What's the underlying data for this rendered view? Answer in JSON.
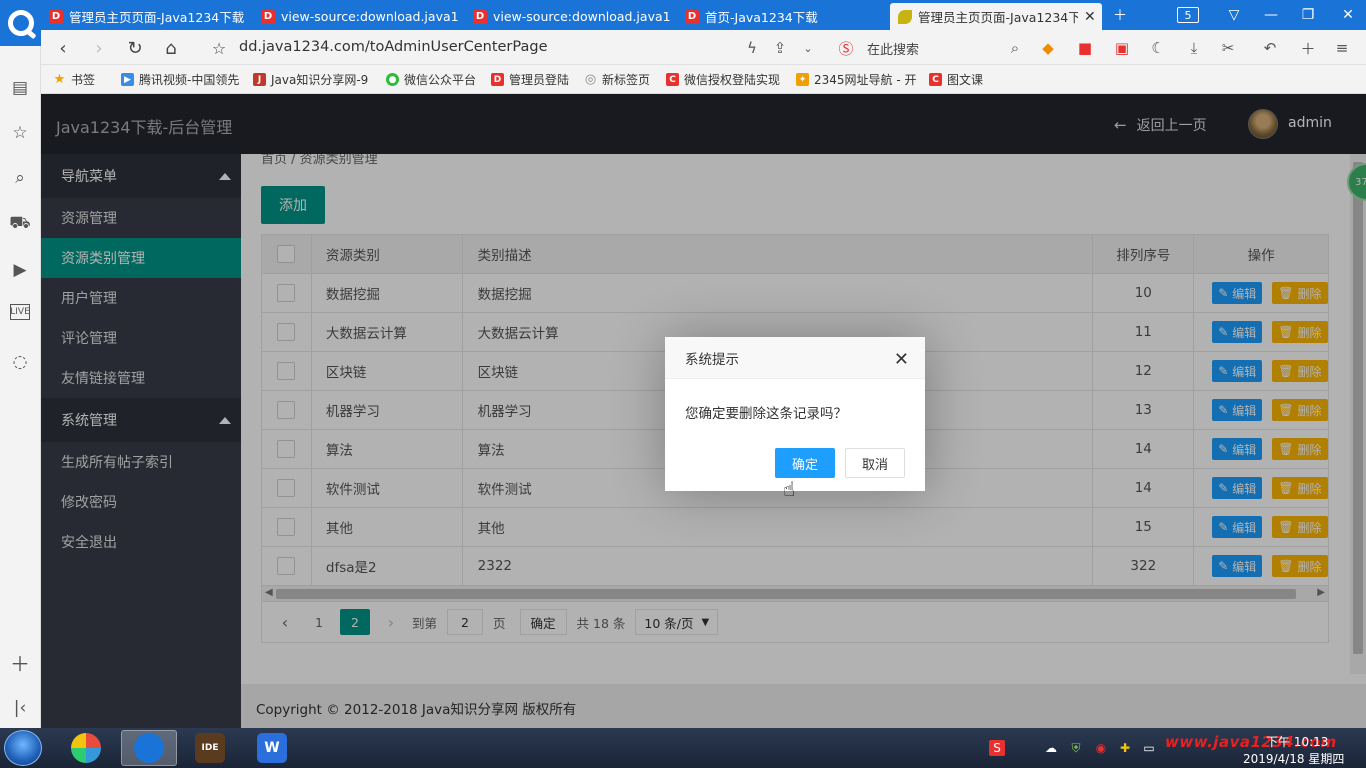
{
  "browser": {
    "tabs": [
      {
        "label": "管理员主页页面-Java1234下载",
        "favicon": "D",
        "active": false
      },
      {
        "label": "view-source:download.java1",
        "favicon": "D",
        "active": false
      },
      {
        "label": "view-source:download.java1",
        "favicon": "D",
        "active": false
      },
      {
        "label": "首页-Java1234下载",
        "favicon": "D",
        "active": false
      },
      {
        "label": "管理员主页页面-Java1234下载",
        "favicon": "",
        "active": true
      }
    ],
    "tab_count": "5",
    "url": "dd.java1234.com/toAdminUserCenterPage",
    "search_placeholder": "在此搜索",
    "bookmarks": [
      {
        "label": "书签",
        "color": "#f0a000"
      },
      {
        "label": "腾讯视频-中国领先",
        "color": "#3c8ce7"
      },
      {
        "label": "Java知识分享网-9",
        "color": "#c0392b"
      },
      {
        "label": "微信公众平台",
        "color": "#2dbb39"
      },
      {
        "label": "管理员登陆",
        "color": "#e8312f"
      },
      {
        "label": "新标签页",
        "color": "#888888"
      },
      {
        "label": "微信授权登陆实现",
        "color": "#e8312f"
      },
      {
        "label": "2345网址导航 - 开",
        "color": "#f0a000"
      },
      {
        "label": "图文课",
        "color": "#e8312f"
      }
    ]
  },
  "app": {
    "title": "Java1234下载-后台管理",
    "back_label": "返回上一页",
    "username": "admin",
    "nav": {
      "group1": "导航菜单",
      "group1_items": [
        "资源管理",
        "资源类别管理",
        "用户管理",
        "评论管理",
        "友情链接管理"
      ],
      "group2": "系统管理",
      "group2_items": [
        "生成所有帖子索引",
        "修改密码",
        "安全退出"
      ],
      "active_item": "资源类别管理"
    },
    "breadcrumb": "首页  /  资源类别管理",
    "add_label": "添加",
    "table": {
      "headers": {
        "name": "资源类别",
        "desc": "类别描述",
        "sort": "排列序号",
        "op": "操作"
      },
      "edit_label": "编辑",
      "delete_label": "删除",
      "rows": [
        {
          "name": "数据挖掘",
          "desc": "数据挖掘",
          "sort": "10"
        },
        {
          "name": "大数据云计算",
          "desc": "大数据云计算",
          "sort": "11"
        },
        {
          "name": "区块链",
          "desc": "区块链",
          "sort": "12"
        },
        {
          "name": "机器学习",
          "desc": "机器学习",
          "sort": "13"
        },
        {
          "name": "算法",
          "desc": "算法",
          "sort": "14"
        },
        {
          "name": "软件测试",
          "desc": "软件测试",
          "sort": "14"
        },
        {
          "name": "其他",
          "desc": "其他",
          "sort": "15"
        },
        {
          "name": "dfsa是2",
          "desc": "2322",
          "sort": "322"
        }
      ]
    },
    "pager": {
      "page1": "1",
      "page2": "2",
      "goto_label": "到第",
      "goto_value": "2",
      "page_suffix": "页",
      "confirm_label": "确定",
      "total": "共 18 条",
      "per_page": "10 条/页"
    },
    "footer": "Copyright © 2012-2018 Java知识分享网 版权所有",
    "float_badge": "37"
  },
  "dialog": {
    "title": "系统提示",
    "message": "您确定要删除这条记录吗？",
    "ok_label": "确定",
    "cancel_label": "取消"
  },
  "taskbar": {
    "time": "下午 10:13",
    "date": "2019/4/18 星期四",
    "watermark": "www.java1234.com"
  }
}
